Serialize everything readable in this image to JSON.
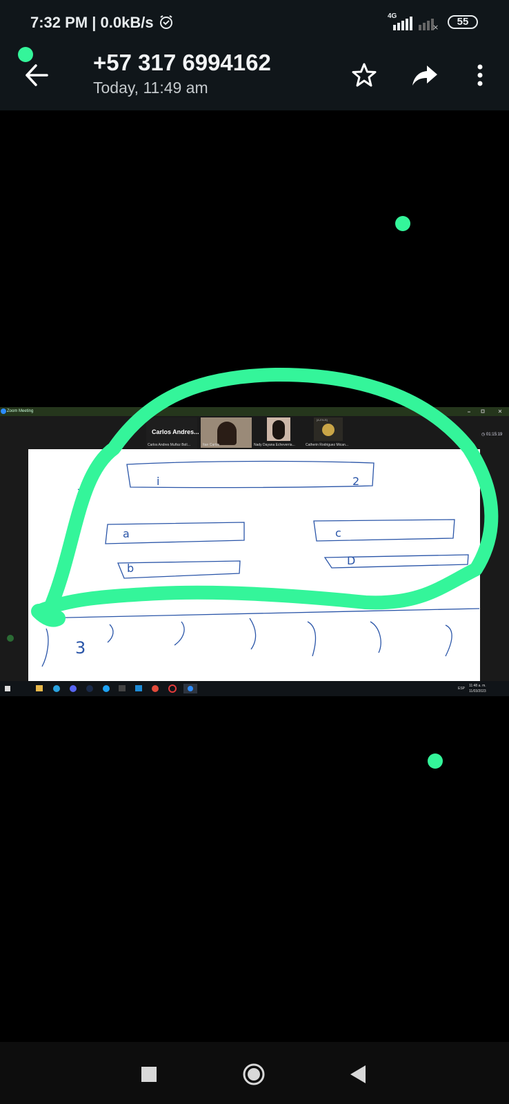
{
  "status": {
    "time": "7:32 PM",
    "speed": "0.0kB/s",
    "network": "4G",
    "battery": "55"
  },
  "header": {
    "contact": "+57 317 6994162",
    "date": "Today, 11:49 am"
  },
  "media": {
    "window_title": "Zoom Meeting",
    "speaker_name": "Carlos Andres...",
    "participants": [
      "Carlos Andres Muñoz Bolí...",
      "Itan Carlos",
      "Nady Dayana Echeverria...",
      "Catherin Rodriguez Mican..."
    ],
    "thumbnail_label": "[A-EN-B]",
    "timer": "01:15:19",
    "whiteboard_marks": [
      "i",
      "2",
      "a",
      "c",
      "b",
      "D",
      "3"
    ],
    "taskbar_lang": "ESP",
    "taskbar_time": "11:48 a. m.",
    "taskbar_date": "11/03/2023"
  },
  "colors": {
    "bar": "#10161a",
    "highlight": "#34f59a",
    "ink": "#2a55a8"
  }
}
